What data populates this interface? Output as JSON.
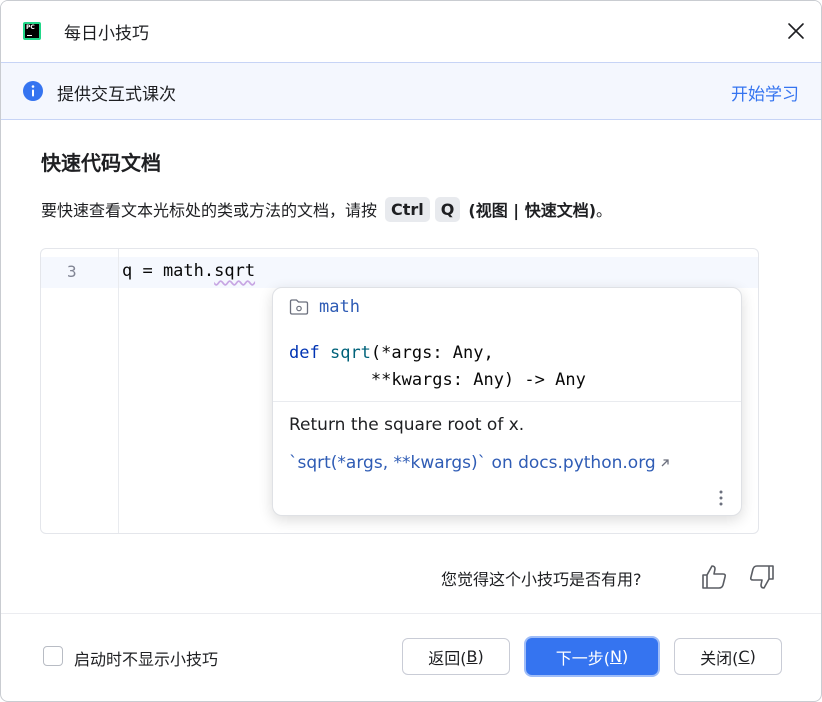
{
  "window": {
    "title": "每日小技巧",
    "app_logo_text": "PC"
  },
  "banner": {
    "text": "提供交互式课次",
    "link": "开始学习"
  },
  "tip": {
    "title": "快速代码文档",
    "desc_prefix": "要快速查看文本光标处的类或方法的文档，请按",
    "key1": "Ctrl",
    "key2": "Q",
    "menu_path": "(视图 | 快速文档)",
    "desc_suffix": "。"
  },
  "editor": {
    "line_number": "3",
    "code_prefix": "q = math.",
    "code_squiggle": "sqrt"
  },
  "doc_popup": {
    "module": "math",
    "sig_def": "def",
    "sig_fn": "sqrt",
    "sig_line1_rest": "(*args: Any,",
    "sig_line2": "        **kwargs: Any) -> Any",
    "description": "Return the square root of x.",
    "link": "`sqrt(*args, **kwargs)` on docs.python.org"
  },
  "feedback": {
    "question": "您觉得这个小技巧是否有用?"
  },
  "footer": {
    "checkbox_label": "启动时不显示小技巧",
    "checkbox_checked": false,
    "back_label": "返回(",
    "back_key": "B",
    "next_label": "下一步(",
    "next_key": "N",
    "close_label": "关闭(",
    "close_key": "C",
    "close_paren": ")"
  },
  "colors": {
    "accent": "#3574f0",
    "link": "#2f5cb5",
    "banner_bg": "#f4f7fe"
  },
  "icons": [
    "pycharm-logo-icon",
    "close-icon",
    "info-icon",
    "folder-icon",
    "external-link-icon",
    "more-vertical-icon",
    "thumbs-up-icon",
    "thumbs-down-icon"
  ]
}
